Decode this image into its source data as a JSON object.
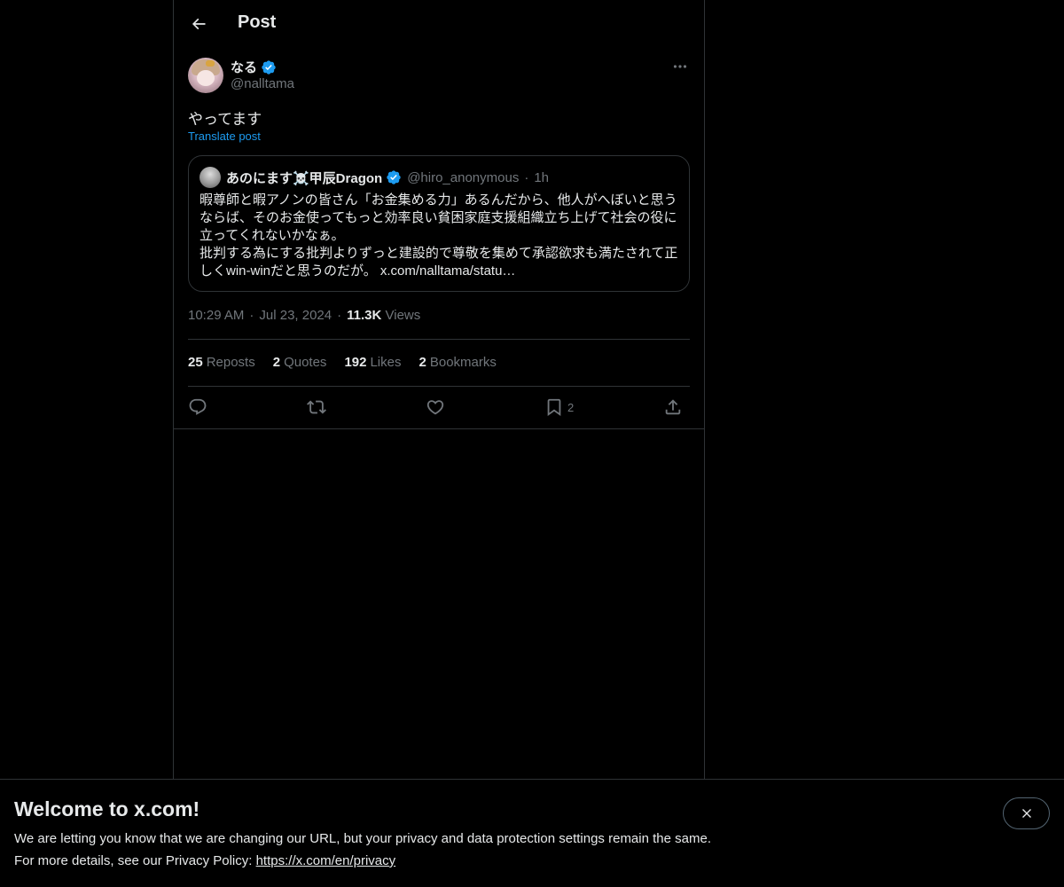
{
  "header": {
    "title": "Post"
  },
  "post": {
    "display_name": "なる",
    "handle": "@nalltama",
    "text": "やってます",
    "translate_label": "Translate post",
    "time": "10:29 AM",
    "date": "Jul 23, 2024",
    "views_count": "11.3K",
    "views_label": "Views",
    "separator": "·"
  },
  "quote": {
    "display_name": "あのにます☠️甲辰Dragon",
    "handle": "@hiro_anonymous",
    "separator": "·",
    "time": "1h",
    "line1": "暇尊師と暇アノンの皆さん「お金集める力」あるんだから、他人がへぼいと思うならば、そのお金使ってもっと効率良い貧困家庭支援組織立ち上げて社会の役に立ってくれないかなぁ。",
    "line2": "批判する為にする批判よりずっと建設的で尊敬を集めて承認欲求も満たされて正しくwin-winだと思うのだが。 x.com/nalltama/statu…"
  },
  "stats": {
    "reposts_count": "25",
    "reposts_label": "Reposts",
    "quotes_count": "2",
    "quotes_label": "Quotes",
    "likes_count": "192",
    "likes_label": "Likes",
    "bookmarks_count": "2",
    "bookmarks_label": "Bookmarks"
  },
  "actions": {
    "bookmark_count": "2"
  },
  "banner": {
    "title": "Welcome to x.com!",
    "line1": "We are letting you know that we are changing our URL, but your privacy and data protection settings remain the same.",
    "line2_prefix": "For more details, see our Privacy Policy: ",
    "link": "https://x.com/en/privacy"
  },
  "colors": {
    "background": "#000000",
    "text": "#e7e9ea",
    "secondary": "#71767b",
    "accent": "#1d9bf0",
    "border": "#2f3336"
  },
  "icons": [
    "back-arrow-icon",
    "verified-badge-icon",
    "more-icon",
    "reply-icon",
    "repost-icon",
    "like-icon",
    "bookmark-icon",
    "share-icon",
    "close-icon"
  ]
}
